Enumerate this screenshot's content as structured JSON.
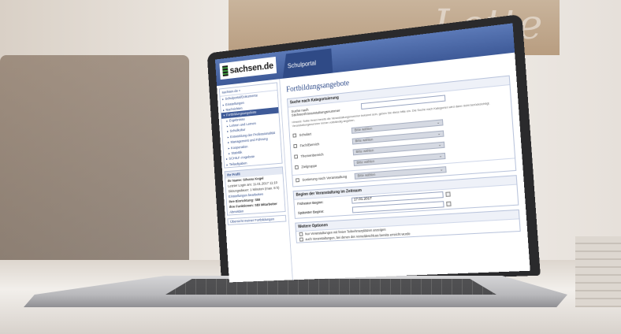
{
  "background": {
    "board_text": "Lotte"
  },
  "header": {
    "logo_text": "sachsen.de",
    "portal_tab": "Schulportal"
  },
  "sidebar": {
    "top_link": "sachsen.de »",
    "menu": [
      {
        "label": "Schulportal/Dokumente",
        "active": false
      },
      {
        "label": "Einstellungen",
        "active": false
      },
      {
        "label": "Nachrichten",
        "active": false
      },
      {
        "label": "Fortbildungsangebote",
        "active": true
      }
    ],
    "submenu": [
      "Ergebnisse",
      "Lehren und Lernen",
      "Schulkultur",
      "Entwicklung der Professionalität",
      "Management und Führung",
      "Kooperation",
      "Statistik"
    ],
    "menu_after": [
      "SCHILF-Angebote",
      "Teilaufgaben"
    ],
    "profile_head": "Ihr Profil",
    "profile_lines": [
      "Ihr Name: Silvana Kogel",
      "Letzter Login am: 11.01.2017 11:10",
      "Sitzungsdauer: 1 Minuten (max. 8 h)",
      "Einstellungen bearbeiten",
      "Ihre Einrichtung: SBI",
      "Ihre Funktionen: SBI Mitarbeiter"
    ],
    "logout": "Abmelden",
    "bottom_link": "Übersicht meiner Fortbildungen"
  },
  "main": {
    "page_title": "Fortbildungsangebote",
    "search_section_title": "Suche nach Kategorisierung",
    "keyword_label": "Suche nach Stichwort/Veranstaltungsnummer",
    "keyword_value": "",
    "hint": "Hinweis: Sollte Ihnen bereits die Veranstaltungsnummer bekannt sein, geben Sie diese bitte ein. Die Suche nach Kategorien wird dann nicht berücksichtigt. Veranstaltungsnummer immer vollständig angeben.",
    "filters": [
      {
        "label": "Schulart",
        "placeholder": "Bitte wählen"
      },
      {
        "label": "Fach/Bereich",
        "placeholder": "Bitte wählen"
      },
      {
        "label": "Themenbereich",
        "placeholder": "Bitte wählen"
      },
      {
        "label": "Zielgruppe",
        "placeholder": "Bitte wählen"
      }
    ],
    "format_filter": {
      "label": "Sortierung nach Veranstaltung",
      "placeholder": "Bitte wählen"
    },
    "date_section_title": "Beginn der Veranstaltung im Zeitraum",
    "date_from_label": "Frühester Beginn:",
    "date_from_value": "17.01.2017",
    "date_to_label": "Spätester Beginn:",
    "date_to_value": "",
    "options_title": "Weitere Optionen",
    "options": [
      "Nur Veranstaltungen mit freien Teilnehmerplätzen anzeigen",
      "auch Veranstaltungen, bei denen der Anmeldeschluss bereits erreicht wurde"
    ]
  }
}
